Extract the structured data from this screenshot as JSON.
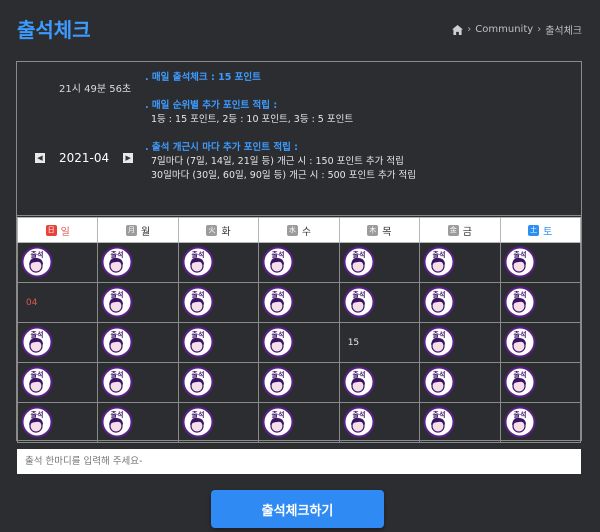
{
  "header": {
    "title": "출석체크",
    "breadcrumb": [
      "Community",
      "출석체크"
    ]
  },
  "clock": "21시 49분 56초",
  "month": {
    "label": "2021-04",
    "prev": "◀",
    "next": "▶"
  },
  "rules": {
    "daily_title": ". 매일 출석체크 : 15 포인트",
    "rank_title": ". 매일 순위별 추가 포인트 적립 :",
    "rank_line": "1등 : 15 포인트,   2등 : 10 포인트,   3등 : 5 포인트",
    "streak_title": ". 출석 개근시 마다 추가 포인트 적립 :",
    "streak_line1": "7일마다 (7일, 14일, 21일 등) 개근 시 : 150 포인트 추가 적립",
    "streak_line2": "30일마다 (30일, 60일, 90일 등) 개근 시 : 500 포인트 추가 적립"
  },
  "weekdays": [
    {
      "chip": "日",
      "label": "일",
      "chip_color": "#e8433b"
    },
    {
      "chip": "月",
      "label": "월",
      "chip_color": "#9c9c9c"
    },
    {
      "chip": "火",
      "label": "화",
      "chip_color": "#9c9c9c"
    },
    {
      "chip": "水",
      "label": "수",
      "chip_color": "#9c9c9c"
    },
    {
      "chip": "木",
      "label": "목",
      "chip_color": "#9c9c9c"
    },
    {
      "chip": "金",
      "label": "금",
      "chip_color": "#9c9c9c"
    },
    {
      "chip": "土",
      "label": "토",
      "chip_color": "#2d8ff0"
    }
  ],
  "calendar": [
    [
      "stamp",
      "stamp",
      "stamp",
      "stamp",
      "stamp",
      "stamp",
      "stamp"
    ],
    [
      "04",
      "stamp",
      "stamp",
      "stamp",
      "stamp",
      "stamp",
      "stamp"
    ],
    [
      "stamp",
      "stamp",
      "stamp",
      "stamp",
      "15",
      "stamp",
      "stamp"
    ],
    [
      "stamp",
      "stamp",
      "stamp",
      "stamp",
      "stamp",
      "stamp",
      "stamp"
    ],
    [
      "stamp",
      "stamp",
      "stamp",
      "stamp",
      "stamp",
      "stamp",
      "stamp"
    ]
  ],
  "comment": {
    "placeholder": "출석 한마디를 입력해 주세요-"
  },
  "submit_label": "출석체크하기",
  "stamp": {
    "text": "출석",
    "ring_color": "#5a1f8a"
  }
}
